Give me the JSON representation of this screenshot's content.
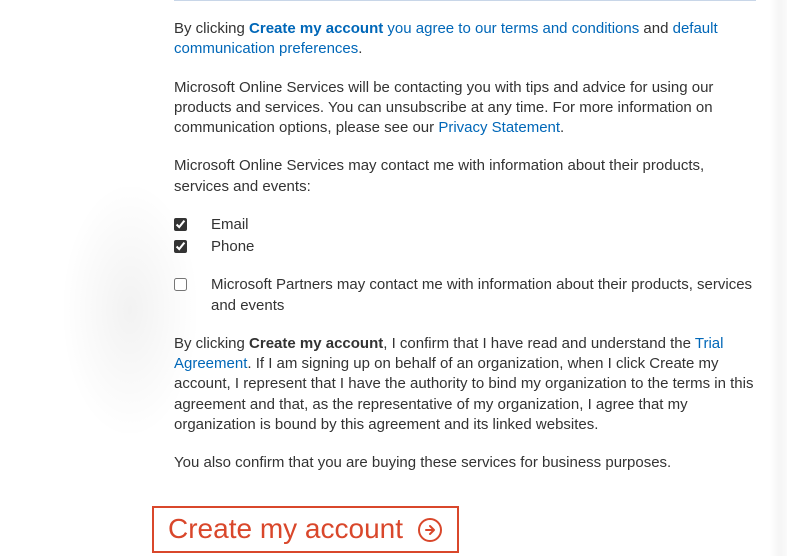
{
  "consent": {
    "line1_prefix": "By clicking ",
    "line1_bold_link": "Create my account",
    "line1_mid": " you agree to our terms and conditions",
    "line1_and": " and ",
    "line1_link2": "default communication preferences",
    "line1_period": "."
  },
  "info_para": {
    "text_a": "Microsoft Online Services will be contacting you with tips and advice for using our products and services. You can unsubscribe at any time. For more information on communication options, please see our ",
    "privacy_link": "Privacy Statement",
    "text_b": "."
  },
  "contact_intro": "Microsoft Online Services may contact me with information about their products, services and events:",
  "options": {
    "email": {
      "label": "Email",
      "checked": true
    },
    "phone": {
      "label": "Phone",
      "checked": true
    }
  },
  "partners": {
    "checked": false,
    "text": "Microsoft Partners may contact me with information about their products, services and events"
  },
  "trial_para": {
    "prefix": "By clicking ",
    "bold": "Create my account",
    "mid": ", I confirm that I have read and understand the ",
    "link": "Trial Agreement",
    "rest": ". If I am signing up on behalf of an organization, when I click Create my account, I represent that I have the authority to bind my organization to the terms in this agreement and that, as the representative of my organization, I agree that my organization is bound by this agreement and its linked websites."
  },
  "business_para": "You also confirm that you are buying these services for business purposes.",
  "cta_label": "Create my account"
}
